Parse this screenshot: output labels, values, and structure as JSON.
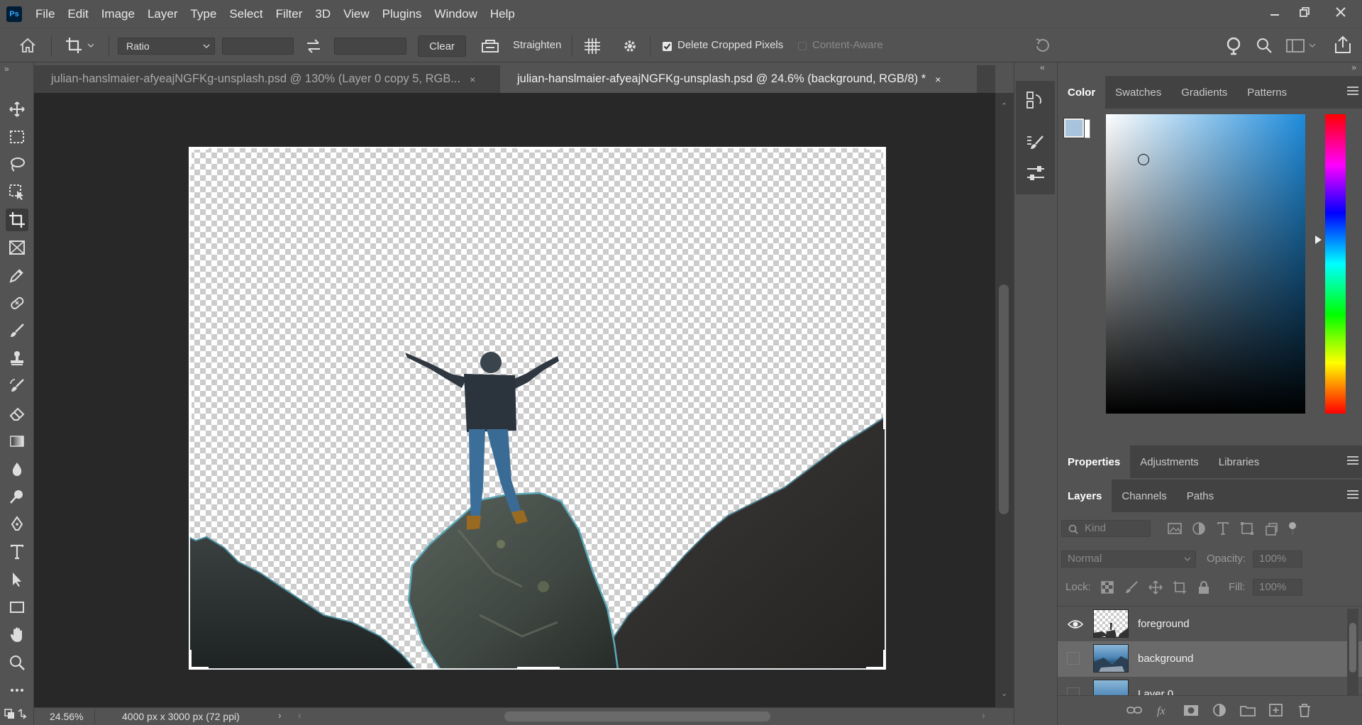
{
  "app": {
    "logo_text": "Ps"
  },
  "menu": [
    "File",
    "Edit",
    "Image",
    "Layer",
    "Type",
    "Select",
    "Filter",
    "3D",
    "View",
    "Plugins",
    "Window",
    "Help"
  ],
  "options": {
    "ratio_select": "Ratio",
    "clear_label": "Clear",
    "straighten_label": "Straighten",
    "delete_cropped_label": "Delete Cropped Pixels",
    "delete_cropped_checked": true,
    "content_aware_label": "Content-Aware",
    "content_aware_checked": false
  },
  "tabs": [
    {
      "label": "julian-hanslmaier-afyeajNGFKg-unsplash.psd @ 130% (Layer 0 copy 5, RGB...",
      "close": "×"
    },
    {
      "label": "julian-hanslmaier-afyeajNGFKg-unsplash.psd @ 24.6% (background, RGB/8) *",
      "close": "×"
    }
  ],
  "status": {
    "zoom": "24.56%",
    "doc_info": "4000 px x 3000 px (72 ppi)"
  },
  "color_panel": {
    "tabs": [
      "Color",
      "Swatches",
      "Gradients",
      "Patterns"
    ],
    "foreground_color": "#a8c4dc",
    "background_color": "#ffffff",
    "hue_color": "#1e8cdc"
  },
  "props_panel": {
    "tabs": [
      "Properties",
      "Adjustments",
      "Libraries"
    ]
  },
  "layers_panel": {
    "tabs": [
      "Layers",
      "Channels",
      "Paths"
    ],
    "kind_placeholder": "Kind",
    "blend_mode": "Normal",
    "opacity_label": "Opacity:",
    "opacity_value": "100%",
    "lock_label": "Lock:",
    "fill_label": "Fill:",
    "fill_value": "100%",
    "layers": [
      {
        "name": "foreground",
        "visible": true,
        "selected": false
      },
      {
        "name": "background",
        "visible": false,
        "selected": true
      },
      {
        "name": "Layer 0",
        "visible": false,
        "selected": false
      }
    ]
  },
  "icons": {
    "tools": [
      "move-icon",
      "marquee-icon",
      "lasso-icon",
      "object-select-icon",
      "crop-icon",
      "frame-icon",
      "eyedropper-icon",
      "healing-icon",
      "brush-icon",
      "stamp-icon",
      "history-brush-icon",
      "eraser-icon",
      "gradient-icon",
      "blur-icon",
      "dodge-icon",
      "pen-icon",
      "type-icon",
      "path-select-icon",
      "rectangle-icon",
      "hand-icon",
      "zoom-icon",
      "more-icon"
    ]
  }
}
